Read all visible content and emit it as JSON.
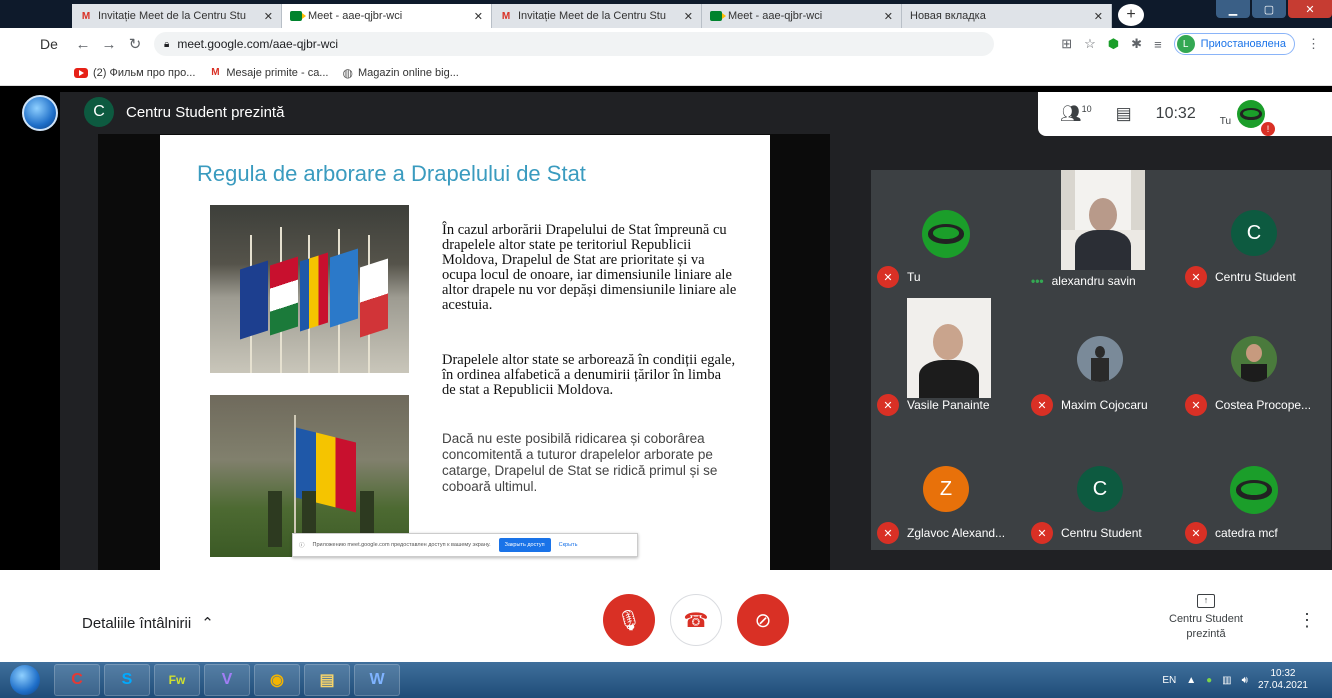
{
  "browser": {
    "tabs": [
      {
        "title": "Invitație Meet de la Centru Stu",
        "icon": "gmail",
        "active": false
      },
      {
        "title": "Meet - aae-qjbr-wci",
        "icon": "meet",
        "active": true
      },
      {
        "title": "Invitație Meet de la Centru Stu",
        "icon": "gmail",
        "active": false
      },
      {
        "title": "Meet - aae-qjbr-wci",
        "icon": "meet",
        "active": false
      },
      {
        "title": "Новая вкладка",
        "icon": "none",
        "active": false
      }
    ],
    "close_glyph": "✕",
    "url": "meet.google.com/aae-qjbr-wci",
    "profile_initial": "L",
    "profile_status": "Приостановлена",
    "side_text": "De",
    "bookmarks": [
      {
        "label": "(2) Фильм про про...",
        "icon": "youtube"
      },
      {
        "label": "Mesaje primite - ca...",
        "icon": "gmail"
      },
      {
        "label": "Magazin online big...",
        "icon": "globe"
      }
    ]
  },
  "meet": {
    "presenter_initial": "C",
    "presenter_text": "Centru Student prezintă",
    "participants_count": "10",
    "clock": "10:32",
    "self_label": "Tu",
    "slide": {
      "title": "Regula de arborare a Drapelului de Stat",
      "p1": "În cazul arborării Drapelului de Stat împreună cu drapelele altor state pe teritoriul Republicii Moldova, Drapelul de Stat are prioritate și va ocupa locul de onoare, iar dimensiunile liniare ale altor drapele nu vor depăși dimensiunile liniare ale acestuia.",
      "p2": "Drapelele altor state se arborează în condiții egale, în ordinea alfabetică a denumirii țărilor în limba de stat a Republicii Moldova.",
      "p3": "Dacă nu este posibilă ridicarea și coborârea concomitentă a tuturor drapelelor arborate pe catarge, Drapelul de Stat se ridică primul și se coboară ultimul."
    },
    "share_notice": {
      "text": "Приложению meet.google.com предоставлен доступ к вашему экрану.",
      "stop_label": "Закрыть доступ",
      "hide_label": "Скрыть"
    },
    "tiles": [
      {
        "name": "Tu",
        "avatar": "blob",
        "muted": true
      },
      {
        "name": "alexandru savin",
        "avatar": "photo",
        "muted": false
      },
      {
        "name": "Centru Student",
        "avatar": "C",
        "color": "#0d5a40",
        "muted": true
      },
      {
        "name": "Vasile Panainte",
        "avatar": "photo",
        "muted": true
      },
      {
        "name": "Maxim Cojocaru",
        "avatar": "small-photo",
        "muted": true
      },
      {
        "name": "Costea Procope...",
        "avatar": "small-photo",
        "muted": true
      },
      {
        "name": "Zglavoc Alexand...",
        "avatar": "Z",
        "color": "#e8710a",
        "muted": true
      },
      {
        "name": "Centru Student",
        "avatar": "C",
        "color": "#0d5a40",
        "muted": true
      },
      {
        "name": "catedra mcf",
        "avatar": "blob",
        "muted": true
      }
    ],
    "meeting_details": "Detaliile întâlnirii",
    "presenting_now": "Centru Student prezintă"
  },
  "taskbar": {
    "lang": "EN",
    "time": "10:32",
    "date": "27.04.2021",
    "apps": [
      "C",
      "S",
      "Fw",
      "V",
      "◉",
      "▤",
      "W"
    ]
  }
}
